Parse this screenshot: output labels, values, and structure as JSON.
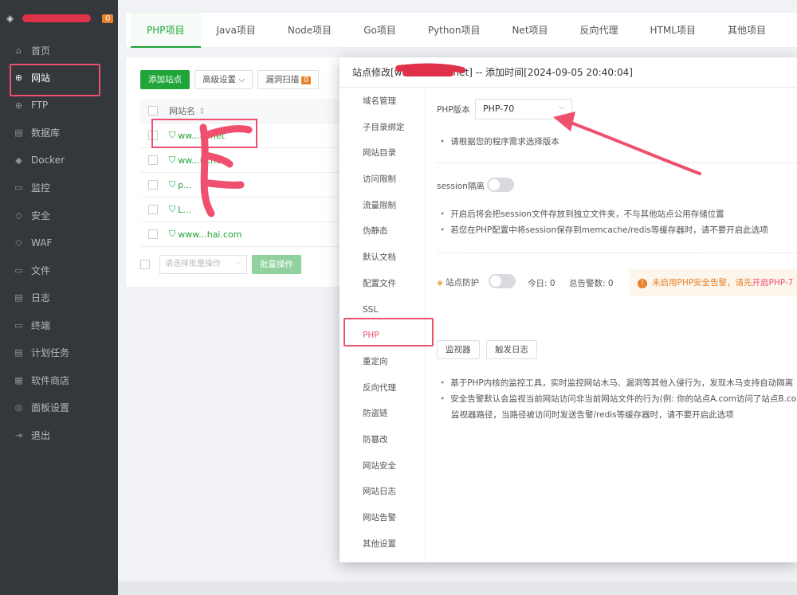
{
  "sidebar": {
    "server_badge": "0",
    "items": [
      {
        "icon": "home-icon",
        "glyph": "⌂",
        "label": "首页"
      },
      {
        "icon": "globe-icon",
        "glyph": "⊕",
        "label": "网站",
        "active": true
      },
      {
        "icon": "ftp-icon",
        "glyph": "⊕",
        "label": "FTP"
      },
      {
        "icon": "database-icon",
        "glyph": "▤",
        "label": "数据库"
      },
      {
        "icon": "docker-icon",
        "glyph": "◆",
        "label": "Docker"
      },
      {
        "icon": "monitor-icon",
        "glyph": "▭",
        "label": "监控"
      },
      {
        "icon": "shield-icon",
        "glyph": "◇",
        "label": "安全"
      },
      {
        "icon": "waf-icon",
        "glyph": "◇",
        "label": "WAF"
      },
      {
        "icon": "folder-icon",
        "glyph": "▭",
        "label": "文件"
      },
      {
        "icon": "log-icon",
        "glyph": "▤",
        "label": "日志"
      },
      {
        "icon": "terminal-icon",
        "glyph": "▭",
        "label": "终端"
      },
      {
        "icon": "task-icon",
        "glyph": "▤",
        "label": "计划任务"
      },
      {
        "icon": "store-icon",
        "glyph": "▦",
        "label": "软件商店"
      },
      {
        "icon": "settings-icon",
        "glyph": "◎",
        "label": "面板设置"
      },
      {
        "icon": "logout-icon",
        "glyph": "⇥",
        "label": "退出"
      }
    ]
  },
  "tabs": [
    "PHP项目",
    "Java项目",
    "Node项目",
    "Go项目",
    "Python项目",
    "Net项目",
    "反向代理",
    "HTML项目",
    "其他项目"
  ],
  "toolbar": {
    "add_site": "添加站点",
    "advanced": "高级设置",
    "vuln_scan": "漏洞扫描",
    "vuln_count": "0"
  },
  "table": {
    "col_name": "网站名",
    "sort_glyph": "⇕",
    "rows": [
      "ww...ai.net",
      "ww...ia.net",
      "p...",
      "L...",
      "www...hai.com"
    ]
  },
  "batch": {
    "placeholder": "请选择批量操作",
    "button": "批量操作"
  },
  "modal": {
    "title_prefix": "站点修改[w",
    "title_suffix": "net] -- 添加时间[2024-09-05 20:40:04]",
    "nav": [
      "域名管理",
      "子目录绑定",
      "网站目录",
      "访问限制",
      "流量限制",
      "伪静态",
      "默认文档",
      "配置文件",
      "SSL",
      "PHP",
      "重定向",
      "反向代理",
      "防盗链",
      "防篡改",
      "网站安全",
      "网站日志",
      "网站告警",
      "其他设置"
    ],
    "php_label": "PHP版本",
    "php_value": "PHP-70",
    "php_tip": "请根据您的程序需求选择版本",
    "session_label": "session隔离",
    "session_tip1": "开启后将会把session文件存放到独立文件夹，不与其他站点公用存储位置",
    "session_tip2": "若您在PHP配置中将session保存到memcache/redis等缓存器时，请不要开启此选项",
    "protect_label": "站点防护",
    "today_label": "今日: 0",
    "total_label": "总告警数: 0",
    "alert_text": "未启用PHP安全告警，请先",
    "alert_link": "开启PHP-7",
    "btn_monitor": "监视器",
    "btn_log": "触发日志",
    "desc1": "基于PHP内核的监控工具，实时监控网站木马、漏洞等其他入侵行为，发现木马支持自动隔离",
    "desc2": "安全告警默认会监视当前网站访问非当前网站文件的行为(例: 你的站点A.com访问了站点B.com的",
    "desc3": "监视器路径，当路径被访问时发送告警/redis等缓存器时，请不要开启此选项"
  },
  "colors": {
    "accent": "#20a53a",
    "highlight": "#f0506e",
    "warning": "#e6822c",
    "sidebar": "#34373c"
  }
}
